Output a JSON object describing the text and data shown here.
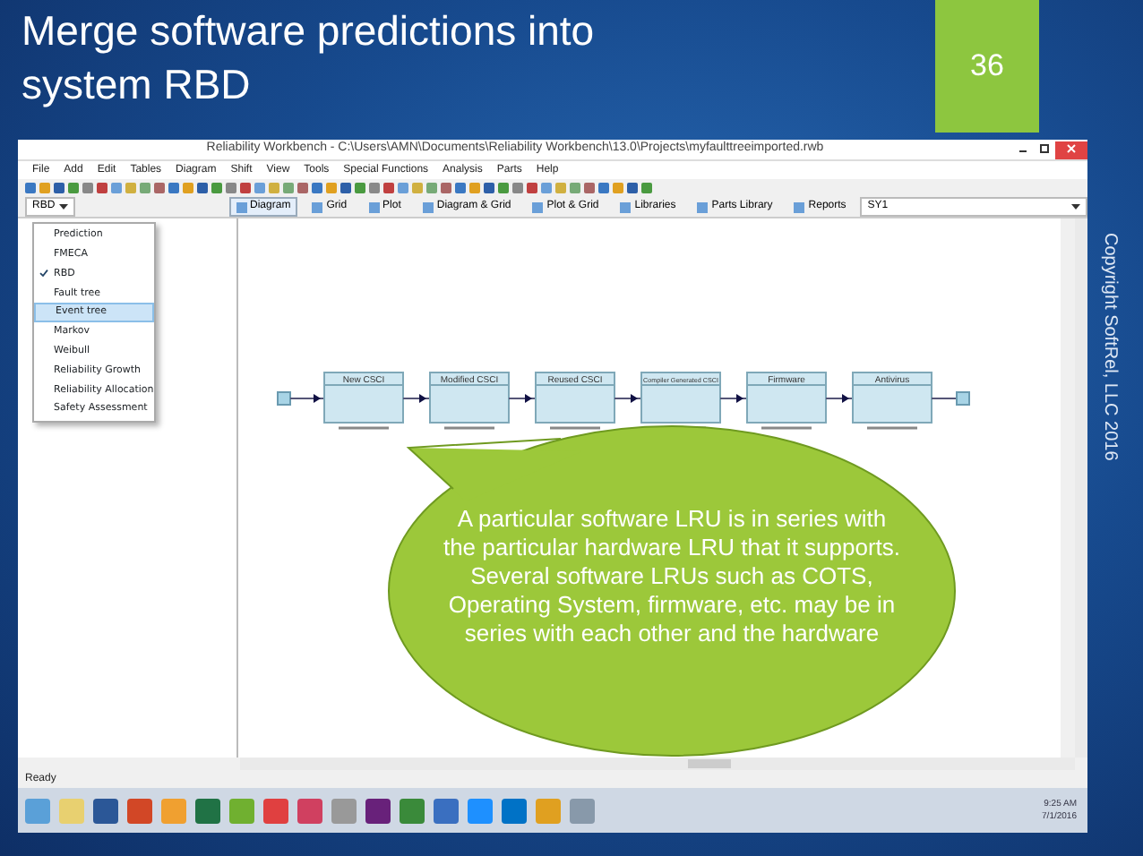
{
  "slide": {
    "title": "Merge software predictions into system RBD",
    "page_number": "36",
    "copyright": "Copyright SoftRel, LLC 2016"
  },
  "window": {
    "title": "Reliability Workbench - C:\\Users\\AMN\\Documents\\Reliability Workbench\\13.0\\Projects\\myfaulttreeimported.rwb",
    "menu": [
      "File",
      "Add",
      "Edit",
      "Tables",
      "Diagram",
      "Shift",
      "View",
      "Tools",
      "Special Functions",
      "Analysis",
      "Parts",
      "Help"
    ],
    "view_selector": "RBD",
    "view_tabs": [
      {
        "label": "Diagram",
        "selected": true
      },
      {
        "label": "Grid",
        "selected": false
      },
      {
        "label": "Plot",
        "selected": false
      },
      {
        "label": "Diagram & Grid",
        "selected": false
      },
      {
        "label": "Plot & Grid",
        "selected": false
      },
      {
        "label": "Libraries",
        "selected": false
      },
      {
        "label": "Parts Library",
        "selected": false
      },
      {
        "label": "Reports",
        "selected": false
      }
    ],
    "system_selector": "SY1",
    "view_menu": [
      {
        "label": "Prediction",
        "checked": false,
        "selected": false
      },
      {
        "label": "FMECA",
        "checked": false,
        "selected": false
      },
      {
        "label": "RBD",
        "checked": true,
        "selected": false
      },
      {
        "label": "Fault tree",
        "checked": false,
        "selected": false
      },
      {
        "label": "Event tree",
        "checked": false,
        "selected": true
      },
      {
        "label": "Markov",
        "checked": false,
        "selected": false
      },
      {
        "label": "Weibull",
        "checked": false,
        "selected": false
      },
      {
        "label": "Reliability Growth",
        "checked": false,
        "selected": false
      },
      {
        "label": "Reliability Allocation",
        "checked": false,
        "selected": false
      },
      {
        "label": "Safety Assessment",
        "checked": false,
        "selected": false
      }
    ],
    "diagram_blocks": [
      "New CSCI",
      "Modified CSCI",
      "Reused CSCI",
      "Compiler Generated CSCI",
      "Firmware",
      "Antivirus"
    ],
    "status_bar": "Ready",
    "clock": {
      "time": "9:25 AM",
      "date": "7/1/2016"
    }
  },
  "callout": "A particular software LRU is in series with the particular hardware LRU that it supports.  Several software LRUs such as COTS, Operating System, firmware, etc. may be in series with each other and the hardware"
}
